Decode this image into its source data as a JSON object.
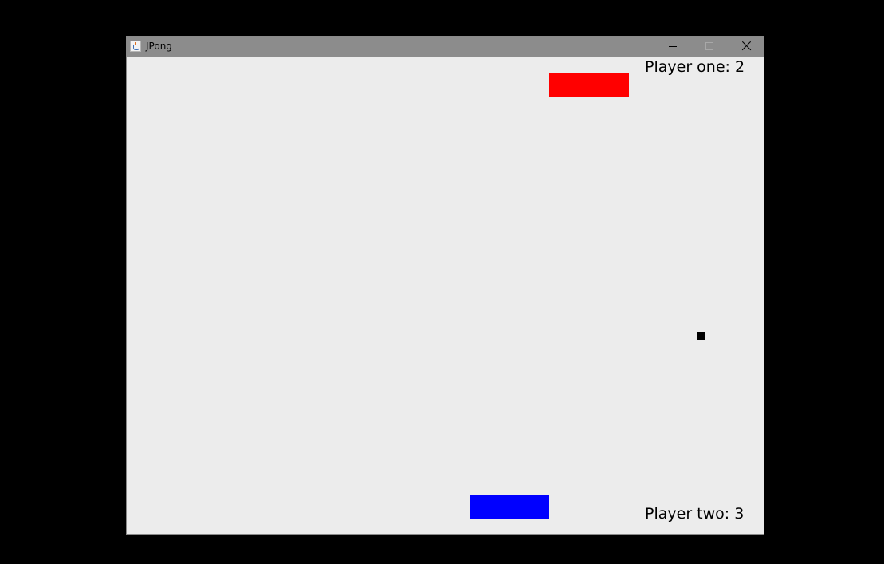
{
  "window": {
    "title": "JPong",
    "icon": "java-cup-icon"
  },
  "controls": {
    "minimize_icon": "minimize-icon",
    "maximize_icon": "maximize-icon",
    "close_icon": "close-icon"
  },
  "game": {
    "score_one": "Player one: 2",
    "score_two": "Player two: 3",
    "colors": {
      "background": "#ececec",
      "paddle_top": "#ff0000",
      "paddle_bottom": "#0000ff",
      "ball": "#000000",
      "titlebar": "#8c8c8c"
    }
  }
}
